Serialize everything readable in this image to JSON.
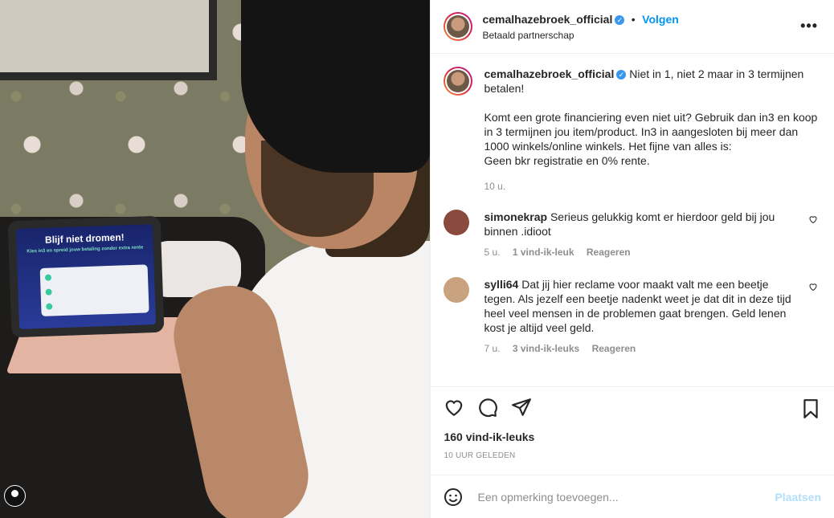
{
  "tablet": {
    "title": "Blijf niet dromen!",
    "subtitle": "Kies in3 en spreid jouw betaling zonder extra rente"
  },
  "header": {
    "username": "cemalhazebroek_official",
    "verified_mark": "✓",
    "separator": "•",
    "follow": "Volgen",
    "subline": "Betaald partnerschap",
    "more": "•••"
  },
  "caption": {
    "username": "cemalhazebroek_official",
    "verified_mark": "✓",
    "text": "Niet in 1, niet 2 maar in 3 termijnen betalen!\n\nKomt een grote financiering even niet uit? Gebruik dan in3 en koop in 3 termijnen jou item/product. In3 in aangesloten bij meer dan 1000 winkels/online winkels. Het fijne van alles is:\nGeen bkr registratie en 0% rente.",
    "time": "10 u."
  },
  "comments": [
    {
      "username": "simonekrap",
      "text": "Serieus gelukkig komt er hierdoor geld bij jou binnen .idioot",
      "time": "5 u.",
      "likes": "1 vind-ik-leuk",
      "reply": "Reageren",
      "avatar_color": "#8a4a3e"
    },
    {
      "username": "sylli64",
      "text": "Dat jij hier reclame voor maakt valt me een beetje tegen. Als jezelf een beetje nadenkt weet je dat dit in deze tijd heel veel mensen in de problemen gaat brengen. Geld lenen kost je altijd veel geld.",
      "time": "7 u.",
      "likes": "3 vind-ik-leuks",
      "reply": "Reageren",
      "avatar_color": "#c9a27f"
    }
  ],
  "actions": {
    "like_icon": "heart-icon",
    "comment_icon": "comment-icon",
    "share_icon": "share-icon",
    "save_icon": "bookmark-icon",
    "likes": "160 vind-ik-leuks",
    "ago": "10 UUR GELEDEN"
  },
  "add_comment": {
    "placeholder": "Een opmerking toevoegen...",
    "post": "Plaatsen",
    "emoji_icon": "smiley-icon"
  },
  "colors": {
    "accent": "#0095f6",
    "post_disabled": "#b2dffc",
    "verified": "#3897f0"
  }
}
